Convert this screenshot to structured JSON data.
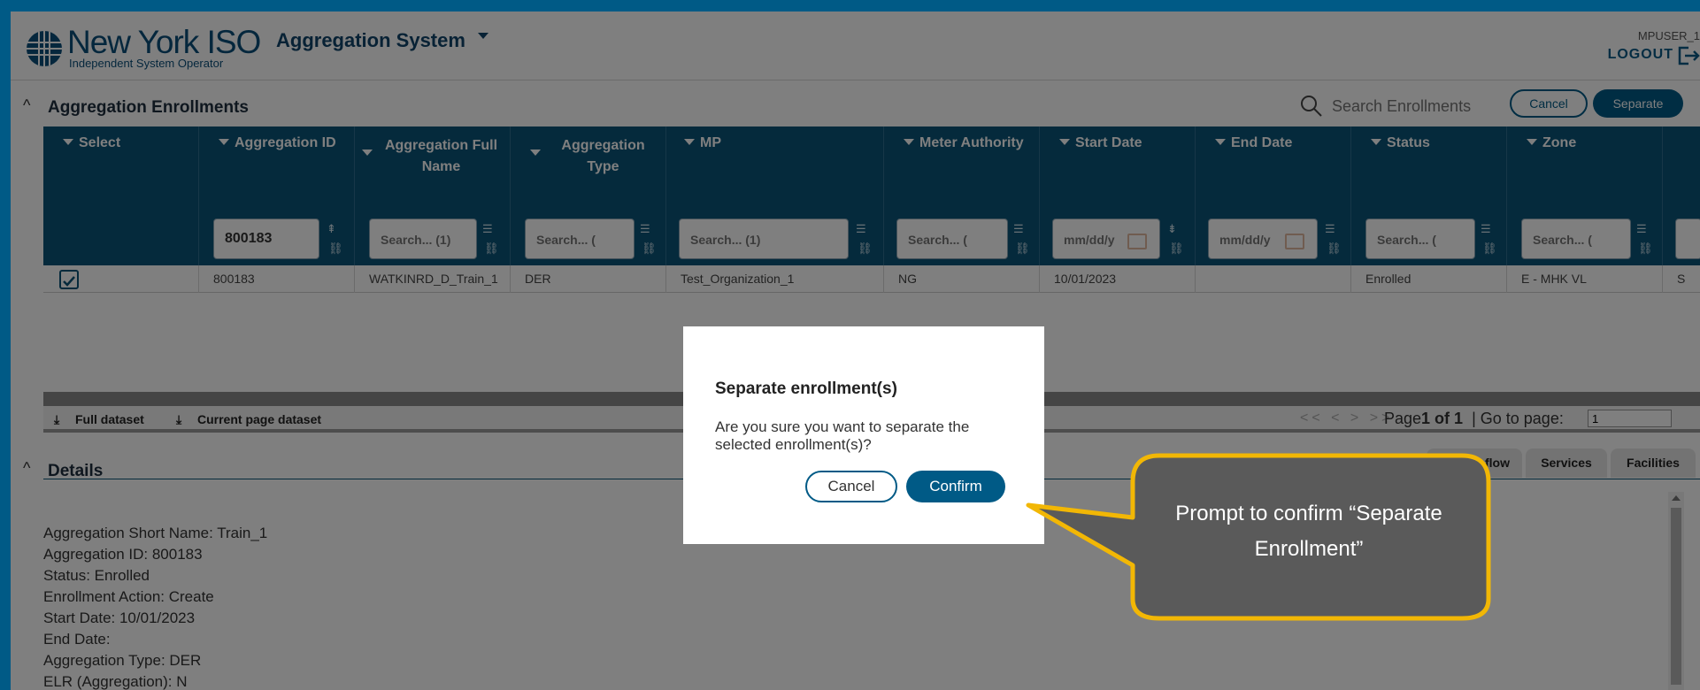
{
  "header": {
    "logo_name": "New York ISO",
    "logo_sub": "Independent System Operator",
    "app_title": "Aggregation System",
    "user": "MPUSER_1",
    "logout": "LOGOUT"
  },
  "enrollments": {
    "title": "Aggregation Enrollments",
    "search_placeholder": "Search Enrollments",
    "cancel_label": "Cancel",
    "separate_label": "Separate"
  },
  "grid": {
    "columns": [
      {
        "title": "Select"
      },
      {
        "title": "Aggregation ID",
        "filter": "800183"
      },
      {
        "title": "Aggregation Full Name",
        "filter": "Search... (1)"
      },
      {
        "title": "Aggregation Type",
        "filter": "Search... ("
      },
      {
        "title": "MP",
        "filter": "Search... (1)"
      },
      {
        "title": "Meter Authority",
        "filter": "Search... ("
      },
      {
        "title": "Start Date",
        "filter": "mm/dd/y"
      },
      {
        "title": "End Date",
        "filter": "mm/dd/y"
      },
      {
        "title": "Status",
        "filter": "Search... ("
      },
      {
        "title": "Zone",
        "filter": "Search... ("
      }
    ],
    "row": {
      "aggregation_id": "800183",
      "full_name": "WATKINRD_D_Train_1",
      "type": "DER",
      "mp": "Test_Organization_1",
      "meter_authority": "NG",
      "start_date": "10/01/2023",
      "end_date": "",
      "status": "Enrolled",
      "zone": "E - MHK VL",
      "overflow": "S"
    }
  },
  "export": {
    "full": "Full dataset",
    "current": "Current page dataset"
  },
  "pager": {
    "nav": "<< < > >>",
    "page_prefix": "Page",
    "page_value": "1 of 1",
    "goto_label": "|  Go to page:",
    "goto_value": "1"
  },
  "details": {
    "title": "Details",
    "tabs": [
      "flow",
      "Services",
      "Facilities"
    ],
    "lines": [
      "Aggregation Short Name: Train_1",
      "Aggregation ID: 800183",
      "Status: Enrolled",
      "Enrollment Action: Create",
      "Start Date: 10/01/2023",
      "End Date:",
      "Aggregation Type: DER",
      "ELR (Aggregation): N"
    ]
  },
  "modal": {
    "title": "Separate enrollment(s)",
    "body": "Are you sure you want to separate the selected enrollment(s)?",
    "cancel": "Cancel",
    "confirm": "Confirm"
  },
  "callout": {
    "text": "Prompt to confirm “Separate Enrollment”"
  },
  "colors": {
    "brand": "#005a86",
    "grid_header": "#0b5479",
    "callout_fill": "#5a5a5a",
    "callout_border": "#f2b705"
  }
}
